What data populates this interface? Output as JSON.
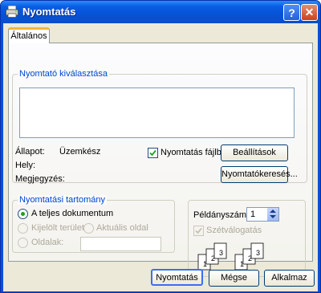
{
  "window": {
    "title": "Nyomtatás",
    "help_glyph": "?",
    "close_glyph": "✕"
  },
  "tabs": [
    {
      "label": "Általános"
    }
  ],
  "printer_group": {
    "title": "Nyomtató kiválasztása",
    "status_label": "Állapot:",
    "status_value": "Üzemkész",
    "location_label": "Hely:",
    "comment_label": "Megjegyzés:",
    "print_to_file": {
      "label": "Nyomtatás fájlba",
      "checked": true
    },
    "settings_button": "Beállítások",
    "find_printer_button": "Nyomtatókeresés..."
  },
  "range_group": {
    "title": "Nyomtatási tartomány",
    "all_option": "A teljes dokumentum",
    "selection_option": "Kijelölt terület",
    "current_page_option": "Aktuális oldal",
    "pages_option": "Oldalak:",
    "pages_value": ""
  },
  "copies": {
    "label": "Példányszám:",
    "value": "1",
    "collate_label": "Szétválogatás",
    "collate_checked": true,
    "collate_disabled": true,
    "page_numbers": [
      "1",
      "2",
      "3"
    ]
  },
  "buttons": {
    "print": "Nyomtatás",
    "cancel": "Mégse",
    "apply": "Alkalmaz"
  },
  "colors": {
    "titlebar": "#0553d6",
    "group_title": "#0046d5",
    "dialog_bg": "#ece9d8"
  }
}
